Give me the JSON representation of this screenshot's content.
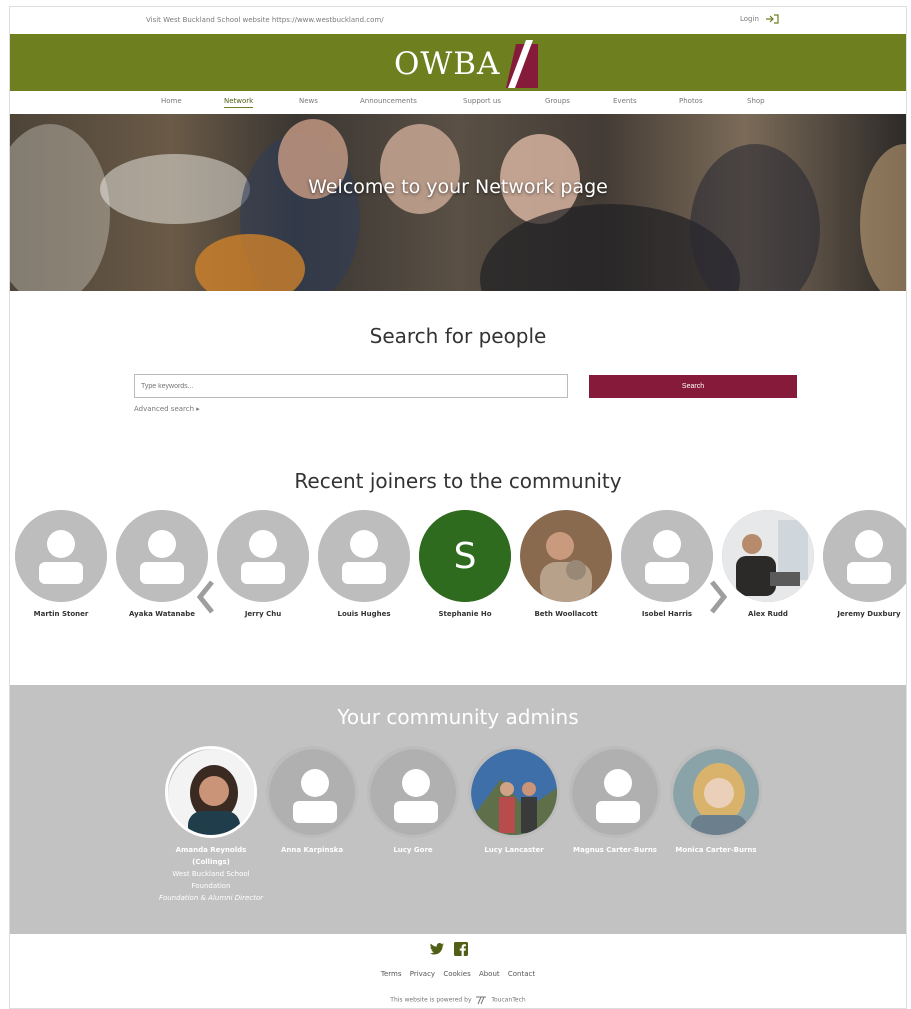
{
  "topbar": {
    "visit_text": "Visit West Buckland School website https://www.westbuckland.com/",
    "login_label": "Login"
  },
  "brand": {
    "logo_text": "OWBA",
    "color": "#6e7f1f",
    "accent": "#861a3a"
  },
  "nav": {
    "items": [
      "Home",
      "Network",
      "News",
      "Announcements",
      "Support us",
      "Groups",
      "Events",
      "Photos",
      "Shop"
    ],
    "active": "Network"
  },
  "hero": {
    "title": "Welcome to your Network page"
  },
  "search": {
    "heading": "Search for people",
    "placeholder": "Type keywords...",
    "button_label": "Search",
    "advanced_label": "Advanced search ▸"
  },
  "recent": {
    "heading": "Recent joiners to the community",
    "people": [
      {
        "name": "Martin Stoner",
        "avatar": "default-user-icon"
      },
      {
        "name": "Ayaka Watanabe",
        "avatar": "default-user-icon"
      },
      {
        "name": "Jerry Chu",
        "avatar": "default-user-icon"
      },
      {
        "name": "Louis Hughes",
        "avatar": "default-user-icon"
      },
      {
        "name": "Stephanie Ho",
        "avatar": "initial",
        "initial": "S"
      },
      {
        "name": "Beth Woollacott",
        "avatar": "photo"
      },
      {
        "name": "Isobel Harris",
        "avatar": "default-user-icon"
      },
      {
        "name": "Alex Rudd",
        "avatar": "photo"
      },
      {
        "name": "Jeremy Duxbury",
        "avatar": "default-user-icon"
      }
    ],
    "prev_icon": "chevron-left-icon",
    "next_icon": "chevron-right-icon"
  },
  "admins": {
    "heading": "Your community admins",
    "people": [
      {
        "name": "Amanda Reynolds (Collings)",
        "org": "West Buckland School Foundation",
        "role": "Foundation & Alumni Director",
        "avatar": "photo"
      },
      {
        "name": "Anna Karpinska",
        "avatar": "default-user-icon"
      },
      {
        "name": "Lucy Gore",
        "avatar": "default-user-icon"
      },
      {
        "name": "Lucy Lancaster",
        "avatar": "photo"
      },
      {
        "name": "Magnus Carter-Burns",
        "avatar": "default-user-icon"
      },
      {
        "name": "Monica Carter-Burns",
        "avatar": "photo"
      }
    ]
  },
  "footer": {
    "social": [
      "twitter-icon",
      "facebook-icon"
    ],
    "links": [
      "Terms",
      "Privacy",
      "Cookies",
      "About",
      "Contact"
    ],
    "powered_by": "This website is powered by",
    "powered_brand": "ToucanTech"
  }
}
